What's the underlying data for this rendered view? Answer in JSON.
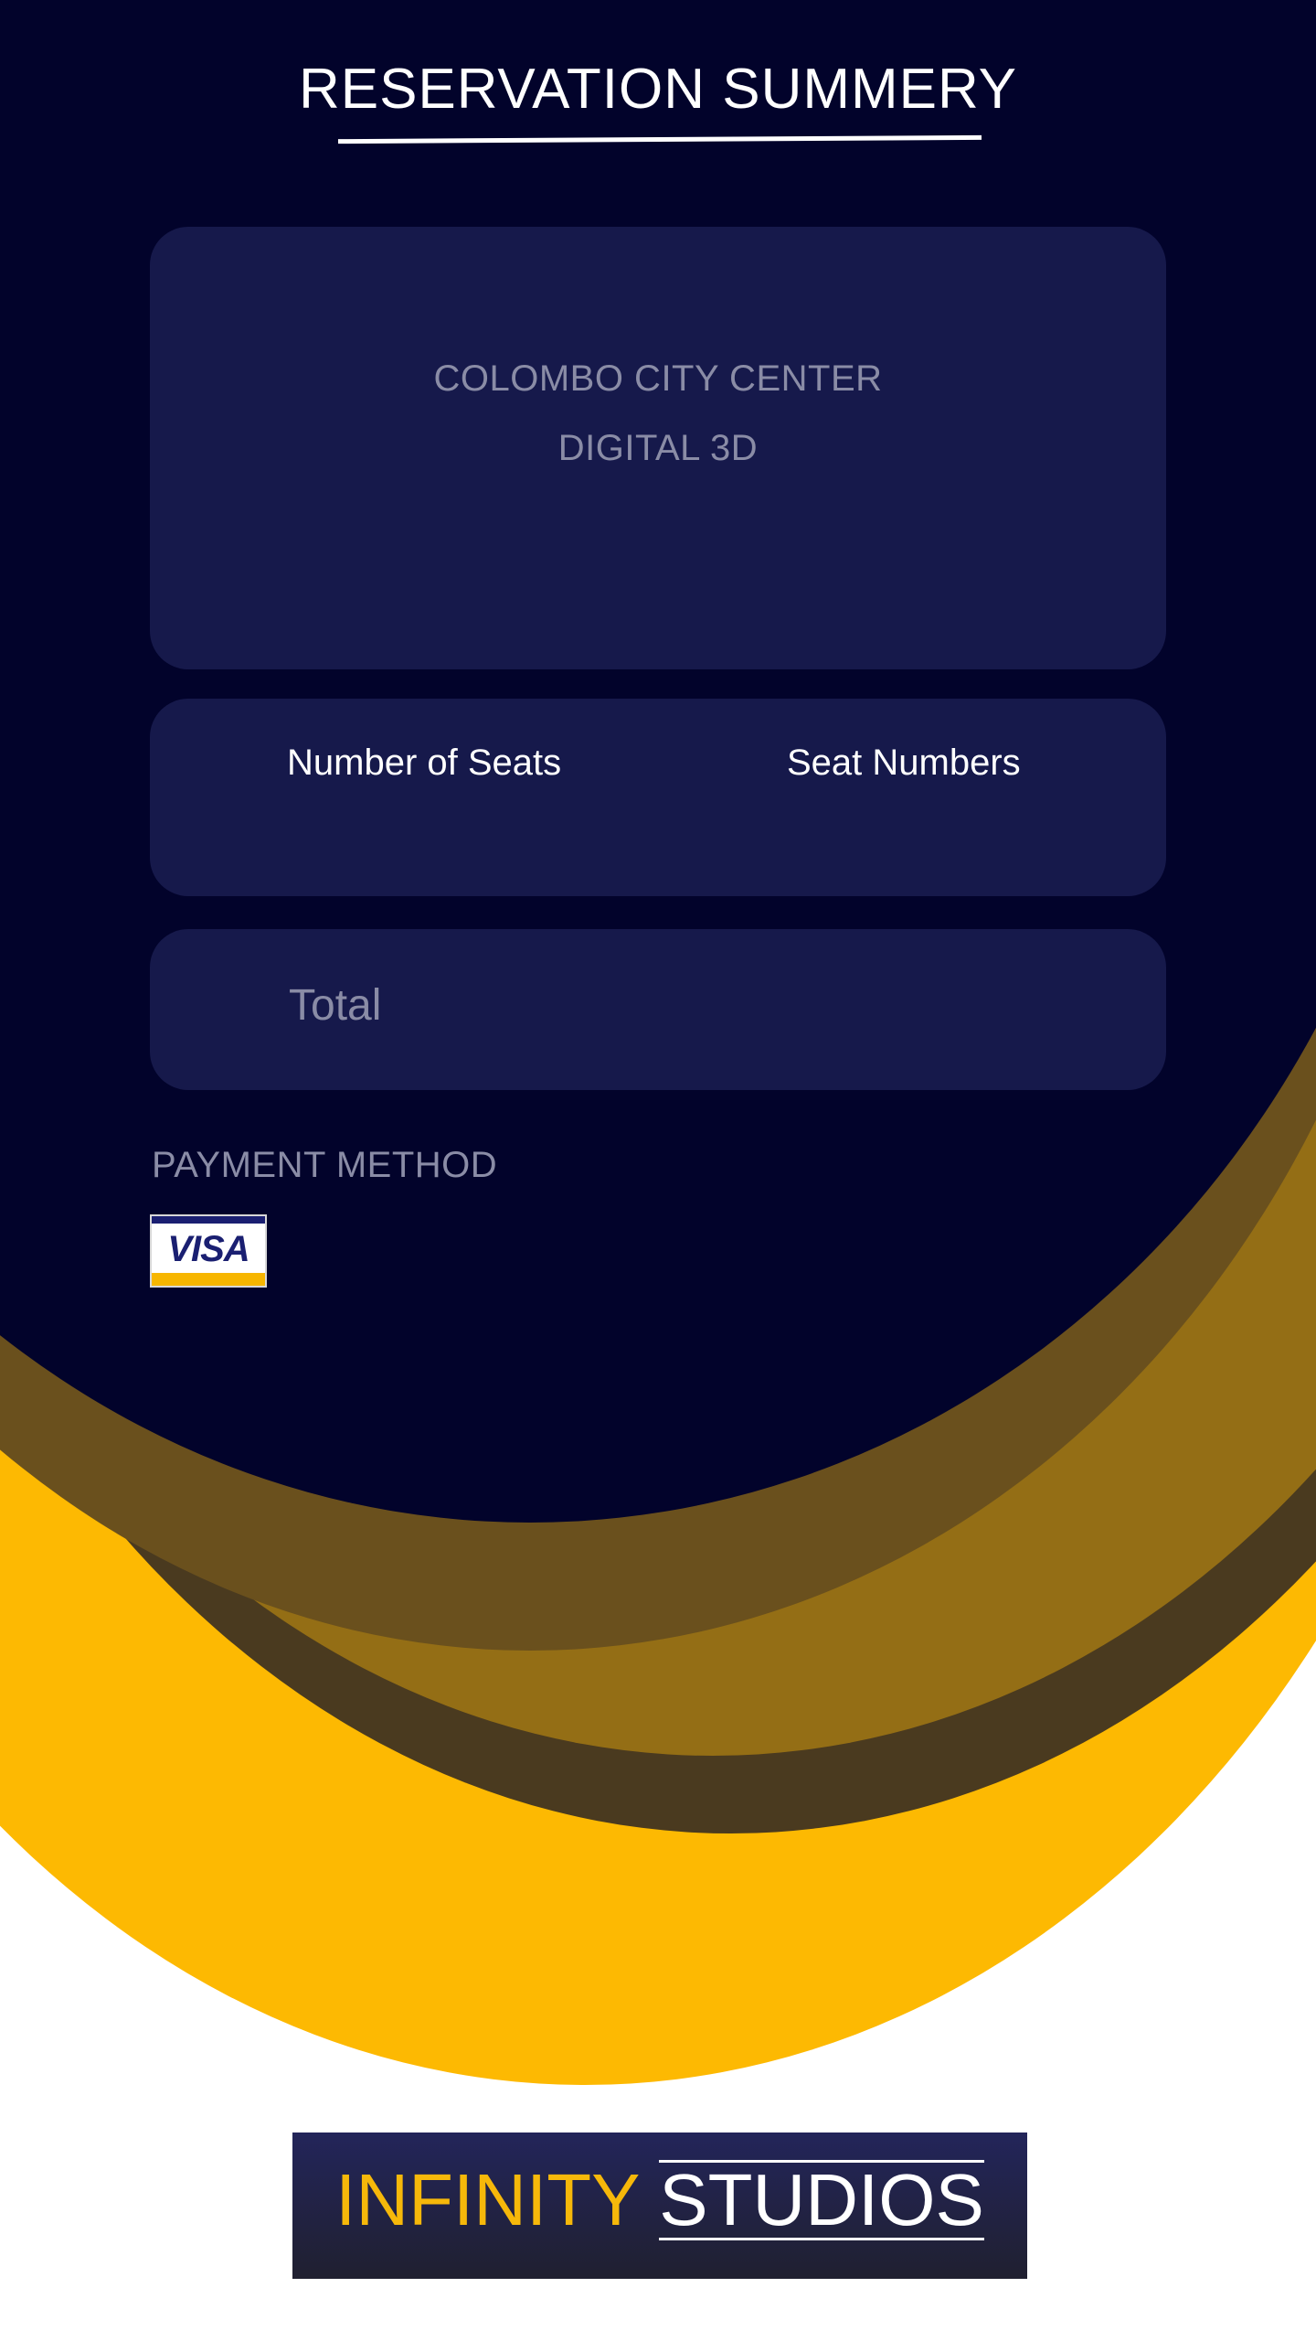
{
  "header": {
    "title": "RESERVATION SUMMERY"
  },
  "venue": {
    "name": "COLOMBO CITY CENTER",
    "format": "DIGITAL 3D"
  },
  "seats": {
    "count_label": "Number of Seats",
    "numbers_label": "Seat Numbers"
  },
  "total": {
    "label": "Total"
  },
  "payment": {
    "label": "PAYMENT METHOD",
    "method": "VISA"
  },
  "brand": {
    "word1": "INFINITY",
    "word2": "STUDIOS"
  },
  "colors": {
    "background_dark": "#02032b",
    "card": "#16194b",
    "accent_yellow": "#fdb902",
    "muted_text": "#8a8ca6"
  }
}
